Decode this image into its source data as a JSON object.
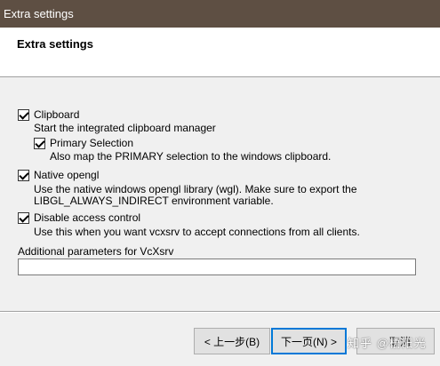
{
  "window": {
    "title": "Extra settings"
  },
  "header": {
    "title": "Extra settings"
  },
  "options": {
    "clipboard": {
      "label": "Clipboard",
      "checked": true,
      "desc": "Start the integrated clipboard manager"
    },
    "primary": {
      "label": "Primary Selection",
      "checked": true,
      "desc": "Also map the PRIMARY selection to the windows clipboard."
    },
    "opengl": {
      "label": "Native opengl",
      "checked": true,
      "desc_line1": "Use the native windows opengl library (wgl). Make sure to export the",
      "desc_line2": "LIBGL_ALWAYS_INDIRECT environment variable."
    },
    "access": {
      "label": "Disable access control",
      "checked": true,
      "desc": "Use this when you want vcxsrv to accept connections from all clients."
    }
  },
  "params": {
    "label": "Additional parameters for VcXsrv",
    "value": ""
  },
  "buttons": {
    "back": "< 上一步(B)",
    "next": "下一页(N) >",
    "cancel": "取消"
  },
  "watermark": "知乎 @梧阳光"
}
